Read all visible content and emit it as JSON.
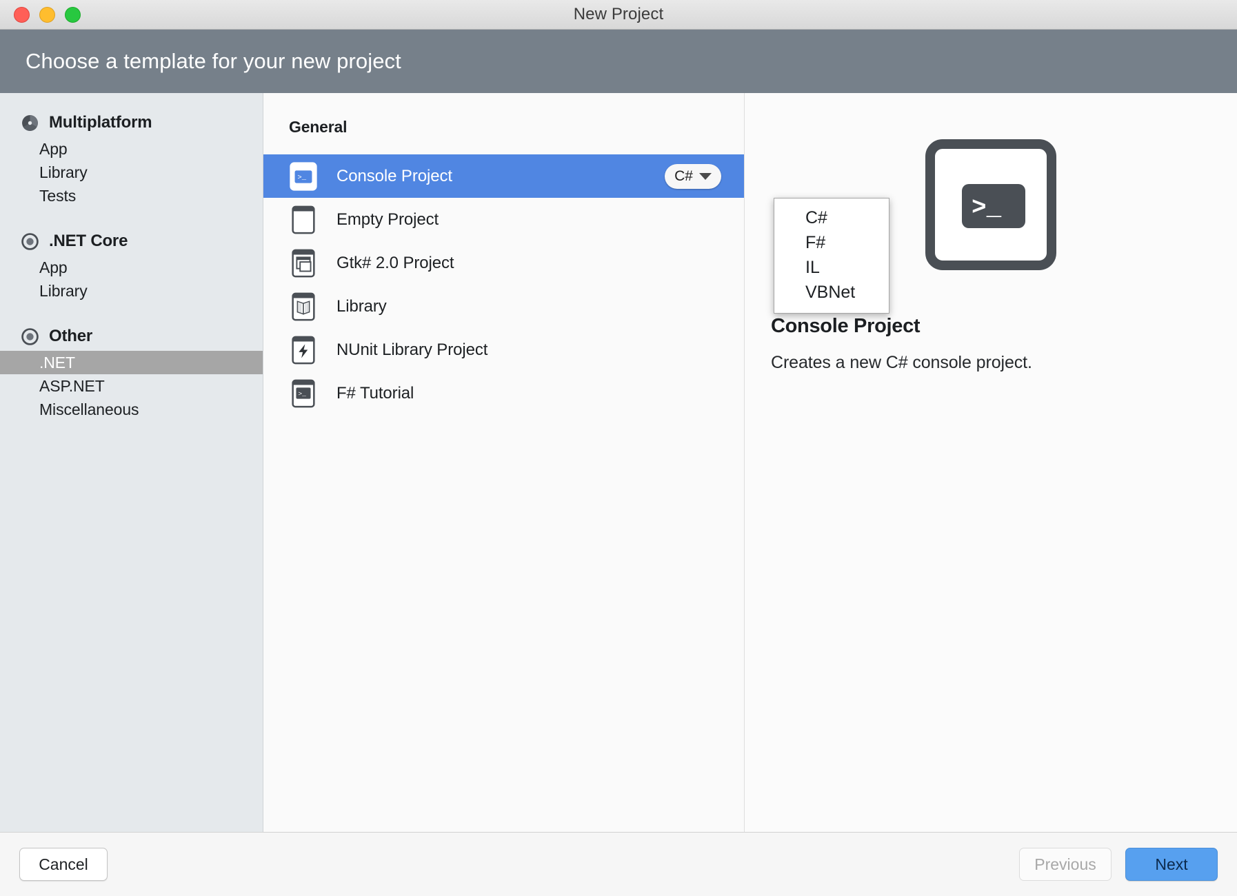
{
  "window": {
    "title": "New Project",
    "traffic_lights": [
      "close",
      "minimize",
      "zoom"
    ]
  },
  "header": {
    "title": "Choose a template for your new project"
  },
  "sidebar": {
    "groups": [
      {
        "label": "Multiplatform",
        "icon": "multiplatform-icon",
        "items": [
          {
            "label": "App",
            "selected": false
          },
          {
            "label": "Library",
            "selected": false
          },
          {
            "label": "Tests",
            "selected": false
          }
        ]
      },
      {
        "label": ".NET Core",
        "icon": "dotnet-core-icon",
        "items": [
          {
            "label": "App",
            "selected": false
          },
          {
            "label": "Library",
            "selected": false
          }
        ]
      },
      {
        "label": "Other",
        "icon": "other-icon",
        "items": [
          {
            "label": ".NET",
            "selected": true
          },
          {
            "label": "ASP.NET",
            "selected": false
          },
          {
            "label": "Miscellaneous",
            "selected": false
          }
        ]
      }
    ]
  },
  "list": {
    "section_title": "General",
    "templates": [
      {
        "label": "Console Project",
        "icon": "console-icon",
        "selected": true,
        "language": "C#"
      },
      {
        "label": "Empty Project",
        "icon": "empty-page-icon",
        "selected": false
      },
      {
        "label": "Gtk# 2.0 Project",
        "icon": "window-icon",
        "selected": false
      },
      {
        "label": "Library",
        "icon": "book-icon",
        "selected": false
      },
      {
        "label": "NUnit Library Project",
        "icon": "bolt-icon",
        "selected": false
      },
      {
        "label": "F# Tutorial",
        "icon": "console-icon",
        "selected": false
      }
    ]
  },
  "language_dropdown": {
    "open": true,
    "selected": "C#",
    "options": [
      "C#",
      "F#",
      "IL",
      "VBNet"
    ]
  },
  "preview": {
    "icon": "console-large-icon",
    "title": "Console Project",
    "description": "Creates a new C# console project."
  },
  "footer": {
    "cancel_label": "Cancel",
    "previous_label": "Previous",
    "next_label": "Next"
  },
  "colors": {
    "header_band": "#76808a",
    "selection_blue": "#5086e2",
    "sidebar_selection": "#a6a6a6",
    "next_button": "#57a0ef",
    "sidebar_bg": "#e5e9ec"
  }
}
